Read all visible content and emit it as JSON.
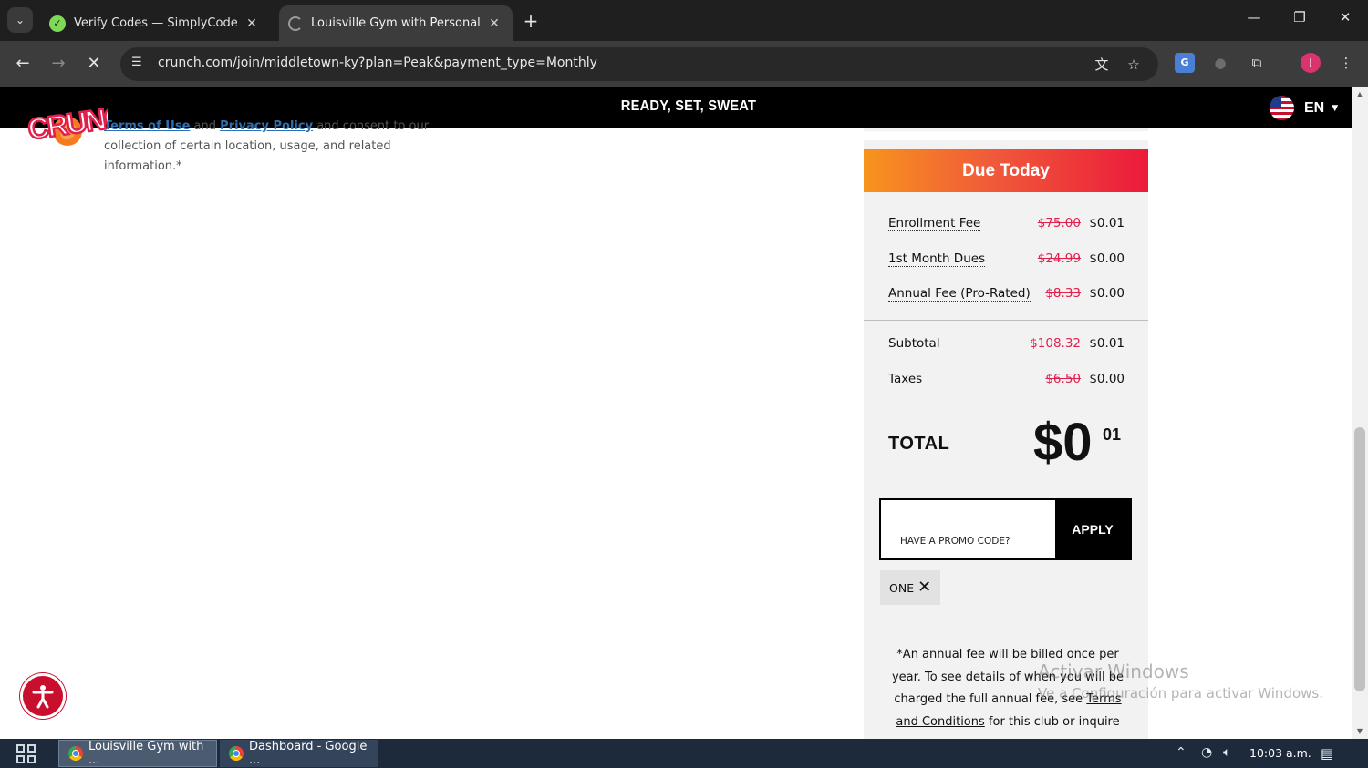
{
  "browser": {
    "tabs": [
      {
        "title": "Verify Codes — SimplyCodes",
        "active": false
      },
      {
        "title": "Louisville Gym with Personal Tra",
        "active": true
      }
    ],
    "url": "crunch.com/join/middletown-ky?plan=Peak&payment_type=Monthly",
    "profile_initial": "J"
  },
  "site": {
    "logo_text": "CRUNCH",
    "tagline": "READY, SET, SWEAT",
    "language": "EN"
  },
  "consent": {
    "terms_link": "Terms of Use",
    "and": "and",
    "privacy_link": "Privacy Policy",
    "tail": "and consent to our",
    "line2": "collection of certain location, usage, and related",
    "line3": "information.*"
  },
  "summary": {
    "header": "Due Today",
    "line_items": [
      {
        "label": "Enrollment Fee",
        "original": "$75.00",
        "price": "$0.01"
      },
      {
        "label": "1st Month Dues",
        "original": "$24.99",
        "price": "$0.00"
      },
      {
        "label": "Annual Fee (Pro-Rated)",
        "original": "$8.33",
        "price": "$0.00"
      }
    ],
    "subtotal": {
      "label": "Subtotal",
      "original": "$108.32",
      "price": "$0.01"
    },
    "taxes": {
      "label": "Taxes",
      "original": "$6.50",
      "price": "$0.00"
    },
    "total_label": "TOTAL",
    "total_dollars": "$0",
    "total_cents": "01",
    "promo_placeholder": "HAVE A PROMO CODE?",
    "apply_label": "APPLY",
    "applied_code": "ONE",
    "note_line1": "*An annual fee will be billed once per",
    "note_line2": "year. To see details of when you will be",
    "note_line3": "charged the full annual fee, see",
    "note_link": "Terms and Conditions",
    "note_tail": "for this club or inquire"
  },
  "watermark": {
    "line1": "Activar Windows",
    "line2": "Ve a Configuración para activar Windows."
  },
  "taskbar": {
    "items": [
      {
        "label": "Louisville Gym with ..."
      },
      {
        "label": "Dashboard - Google ..."
      }
    ],
    "clock": "10:03 a.m."
  }
}
